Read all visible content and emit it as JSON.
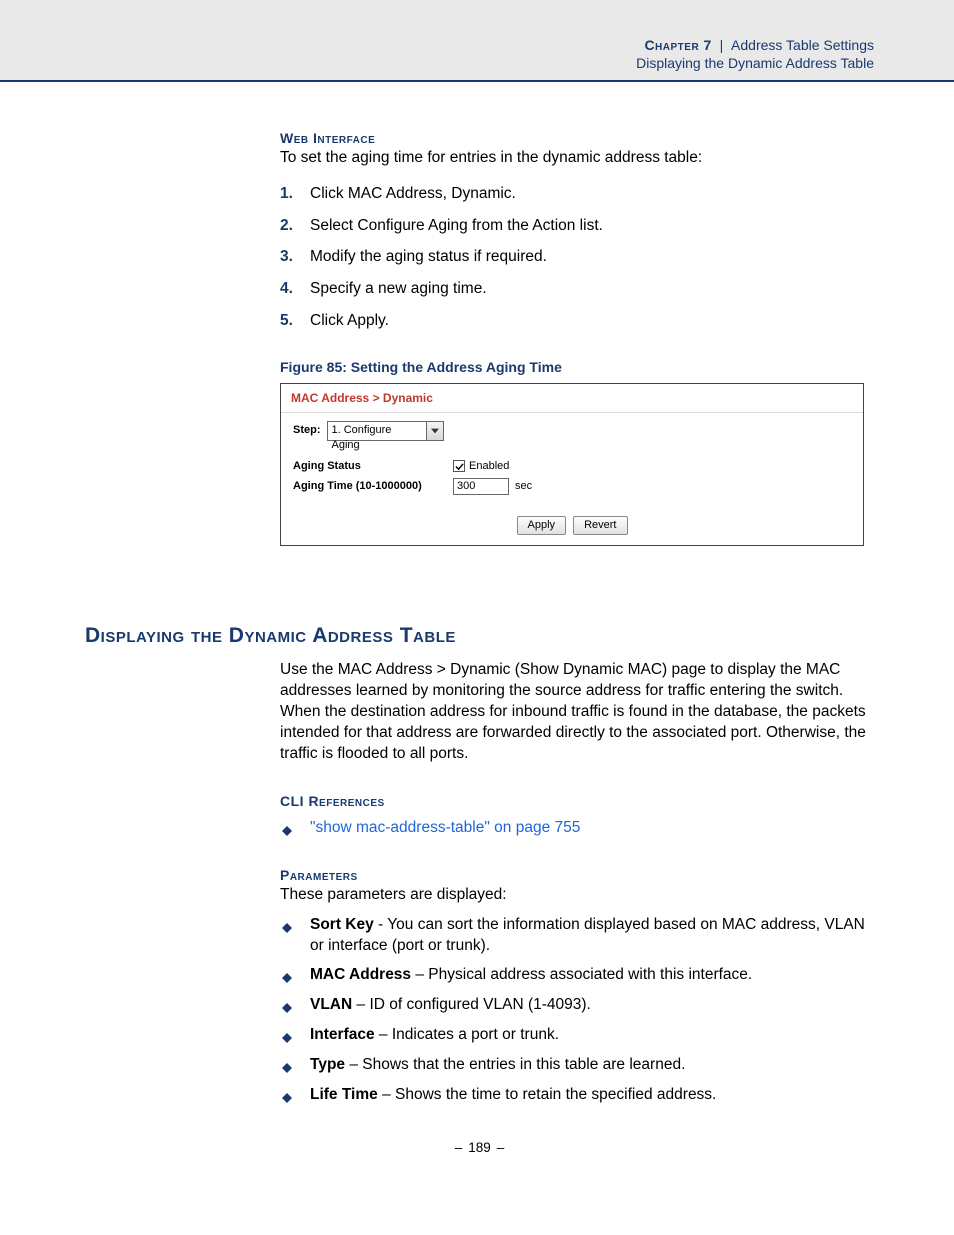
{
  "header": {
    "chapter": "Chapter 7",
    "sep": "|",
    "crumb": "Address Table Settings",
    "sub": "Displaying the Dynamic Address Table"
  },
  "web_interface": {
    "title": "Web Interface",
    "intro": "To set the aging time for entries in the dynamic address table:",
    "steps": [
      "Click MAC Address, Dynamic.",
      "Select Configure Aging from the Action list.",
      "Modify the aging status if required.",
      "Specify a new aging time.",
      "Click Apply."
    ]
  },
  "figure": {
    "caption": "Figure 85:  Setting the Address Aging Time",
    "breadcrumb": "MAC Address > Dynamic",
    "step_label": "Step:",
    "step_select": "1. Configure Aging",
    "aging_status_label": "Aging Status",
    "aging_status_text": "Enabled",
    "aging_time_label": "Aging Time (10-1000000)",
    "aging_time_value": "300",
    "aging_time_unit": "sec",
    "apply": "Apply",
    "revert": "Revert"
  },
  "section2": {
    "title": "Displaying the Dynamic Address Table",
    "para": "Use the MAC Address > Dynamic (Show Dynamic MAC) page to display the MAC addresses learned by monitoring the source address for traffic entering the switch. When the destination address for inbound traffic is found in the database, the packets intended for that address are forwarded directly to the associated port. Otherwise, the traffic is flooded to all ports."
  },
  "cli": {
    "title": "CLI References",
    "link": "\"show mac-address-table\" on page 755"
  },
  "params": {
    "title": "Parameters",
    "intro": "These parameters are displayed:",
    "items": [
      {
        "name": "Sort Key",
        "sep": " - ",
        "desc": "You can sort the information displayed based on MAC address, VLAN or interface (port or trunk)."
      },
      {
        "name": "MAC Address",
        "sep": " – ",
        "desc": "Physical address associated with this interface."
      },
      {
        "name": "VLAN",
        "sep": " – ",
        "desc": "ID of configured VLAN (1-4093)."
      },
      {
        "name": "Interface",
        "sep": " – ",
        "desc": "Indicates a port or trunk."
      },
      {
        "name": "Type",
        "sep": " – ",
        "desc": "Shows that the entries in this table are learned."
      },
      {
        "name": "Life Time",
        "sep": " – ",
        "desc": "Shows the time to retain the specified address."
      }
    ]
  },
  "page_number": "189"
}
